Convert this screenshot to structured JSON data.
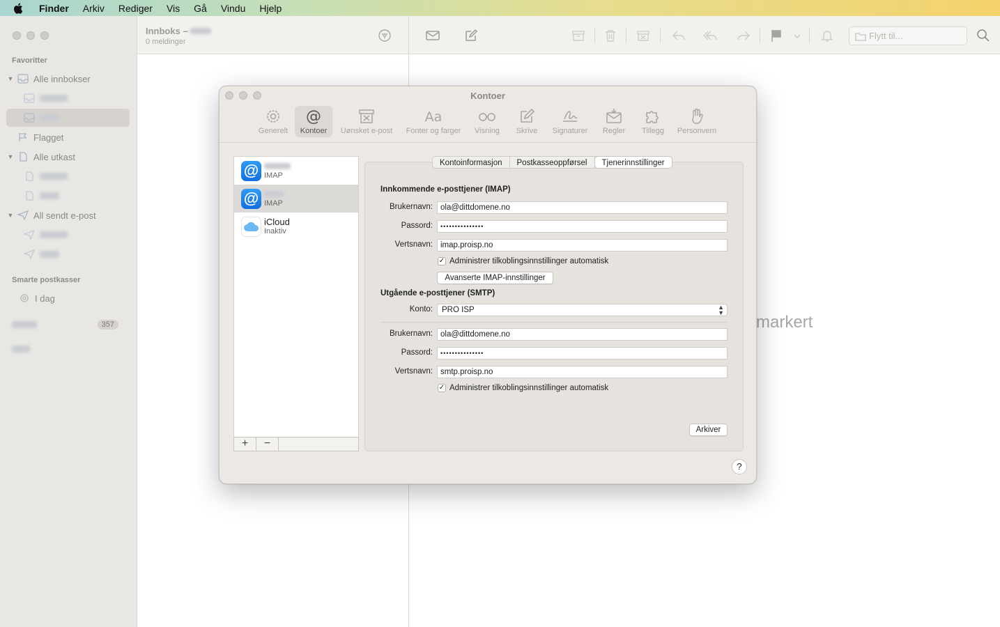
{
  "menubar": {
    "items": [
      "Finder",
      "Arkiv",
      "Rediger",
      "Vis",
      "Gå",
      "Vindu",
      "Hjelp"
    ]
  },
  "sidebar": {
    "favorites_title": "Favoritter",
    "all_inboxes": "Alle innbokser",
    "flagged": "Flagget",
    "all_drafts": "Alle utkast",
    "all_sent": "All sendt e-post",
    "smart_title": "Smarte postkasser",
    "today": "I dag",
    "badge_count": "357"
  },
  "list": {
    "title": "Innboks –",
    "subtitle": "0 meldinger"
  },
  "reader": {
    "move_placeholder": "Flytt til...",
    "no_selection_partial": "markert"
  },
  "dialog": {
    "title": "Kontoer",
    "tabs": [
      {
        "label": "Generelt",
        "icon": "gear-icon"
      },
      {
        "label": "Kontoer",
        "icon": "at-icon"
      },
      {
        "label": "Uønsket e-post",
        "icon": "junk-icon"
      },
      {
        "label": "Fonter og farger",
        "icon": "fonts-icon"
      },
      {
        "label": "Visning",
        "icon": "glasses-icon"
      },
      {
        "label": "Skrive",
        "icon": "compose-icon"
      },
      {
        "label": "Signaturer",
        "icon": "signature-icon"
      },
      {
        "label": "Regler",
        "icon": "rules-icon"
      },
      {
        "label": "Tillegg",
        "icon": "puzzle-icon"
      },
      {
        "label": "Personvern",
        "icon": "hand-icon"
      }
    ],
    "accounts": [
      {
        "type": "IMAP"
      },
      {
        "type": "IMAP"
      },
      {
        "name": "iCloud",
        "type": "Inaktiv"
      }
    ],
    "segments": [
      "Kontoinformasjon",
      "Postkasseoppførsel",
      "Tjenerinnstillinger"
    ],
    "incoming": {
      "heading": "Innkommende e-posttjener (IMAP)",
      "username_label": "Brukernavn:",
      "username": "ola@dittdomene.no",
      "password_label": "Passord:",
      "password": "•••••••••••••••",
      "host_label": "Vertsnavn:",
      "host": "imap.proisp.no",
      "auto_manage": "Administrer tilkoblingsinnstillinger automatisk",
      "advanced_button": "Avanserte IMAP-innstillinger"
    },
    "outgoing": {
      "heading": "Utgående e-posttjener (SMTP)",
      "account_label": "Konto:",
      "account": "PRO ISP",
      "username_label": "Brukernavn:",
      "username": "ola@dittdomene.no",
      "password_label": "Passord:",
      "password": "•••••••••••••••",
      "host_label": "Vertsnavn:",
      "host": "smtp.proisp.no",
      "auto_manage": "Administrer tilkoblingsinnstillinger automatisk"
    },
    "save_button": "Arkiver",
    "add_button": "+",
    "remove_button": "−",
    "help_button": "?"
  }
}
